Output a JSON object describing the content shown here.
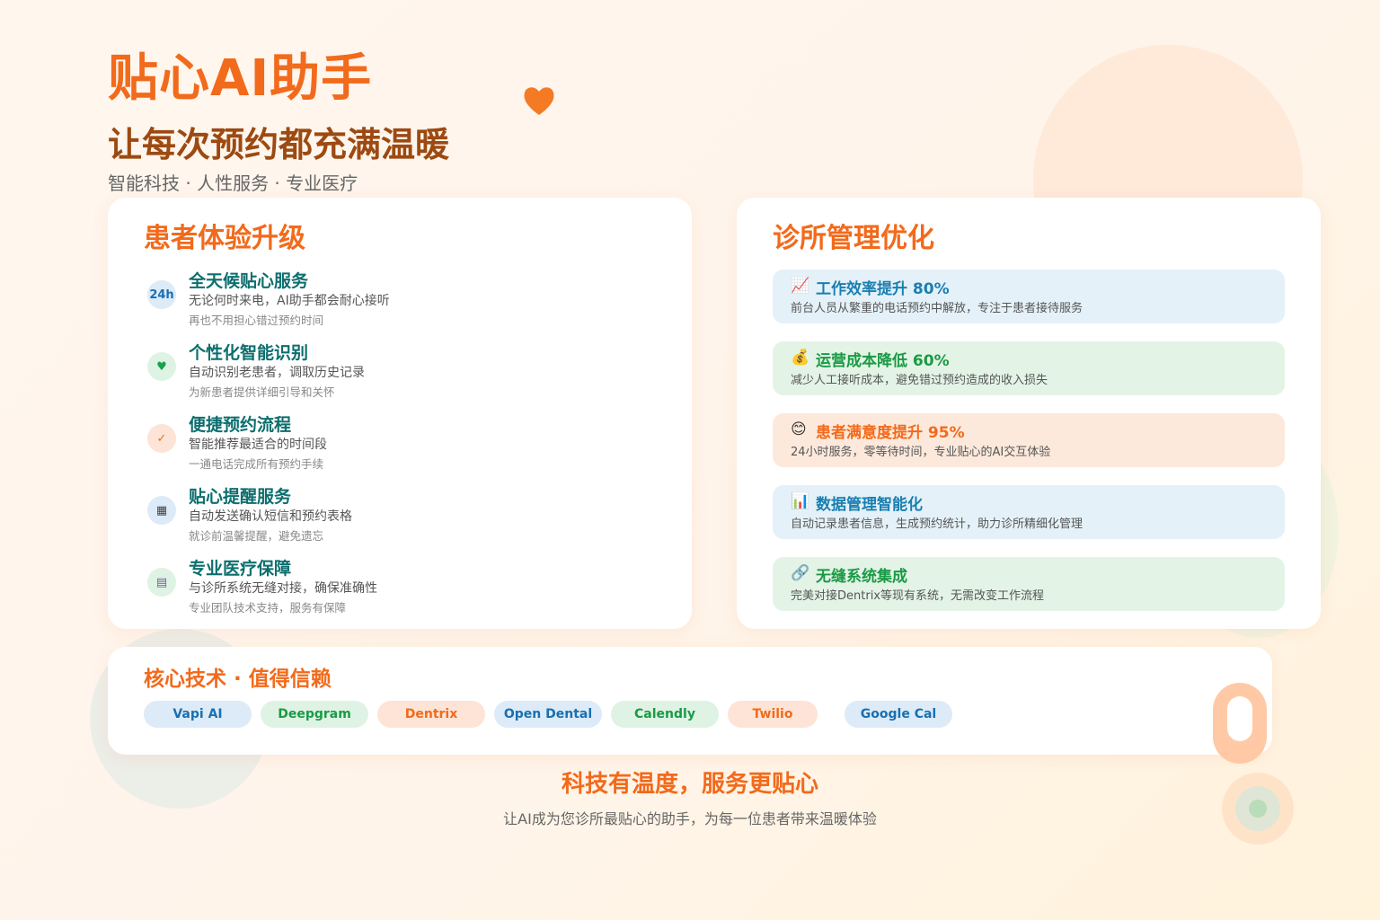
{
  "header": {
    "title": "贴心AI助手",
    "subtitle": "让每次预约都充满温暖",
    "tagline": "智能科技 · 人性服务 · 专业医疗",
    "heart_icon": "heart-icon"
  },
  "patient_card": {
    "title": "患者体验升级",
    "features": [
      {
        "icon_text": "24h",
        "icon": "clock-24h-icon",
        "icon_bg": "#dcebf7",
        "icon_color": "#1a6fb0",
        "title": "全天候贴心服务",
        "desc": "无论何时来电，AI助手都会耐心接听",
        "note": "再也不用担心错过预约时间"
      },
      {
        "icon_text": "♥",
        "icon": "green-heart-icon",
        "icon_bg": "#dff3e4",
        "icon_color": "#1aa24a",
        "title": "个性化智能识别",
        "desc": "自动识别老患者，调取历史记录",
        "note": "为新患者提供详细引导和关怀"
      },
      {
        "icon_text": "✓",
        "icon": "check-icon",
        "icon_bg": "#fde4d6",
        "icon_color": "#f26a1b",
        "title": "便捷预约流程",
        "desc": "智能推荐最适合的时间段",
        "note": "一通电话完成所有预约手续"
      },
      {
        "icon_text": "▦",
        "icon": "phone-icon",
        "icon_bg": "#dcebf7",
        "icon_color": "#444",
        "title": "贴心提醒服务",
        "desc": "自动发送确认短信和预约表格",
        "note": "就诊前温馨提醒，避免遗忘"
      },
      {
        "icon_text": "▤",
        "icon": "clipboard-icon",
        "icon_bg": "#dff3e4",
        "icon_color": "#7a5aa8",
        "title": "专业医疗保障",
        "desc": "与诊所系统无缝对接，确保准确性",
        "note": "专业团队技术支持，服务有保障"
      }
    ]
  },
  "clinic_card": {
    "title": "诊所管理优化",
    "metrics": [
      {
        "icon_text": "📈",
        "icon": "chart-up-icon",
        "bg": "#e4f1f8",
        "color": "#1a7fb0",
        "title": "工作效率提升 80%",
        "desc": "前台人员从繁重的电话预约中解放，专注于患者接待服务"
      },
      {
        "icon_text": "💰",
        "icon": "money-bag-icon",
        "bg": "#e3f4e6",
        "color": "#1a9a45",
        "title": "运营成本降低 60%",
        "desc": "减少人工接听成本，避免错过预约造成的收入损失"
      },
      {
        "icon_text": "😊",
        "icon": "smile-icon",
        "bg": "#fde9dc",
        "color": "#f26a1b",
        "title": "患者满意度提升 95%",
        "desc": "24小时服务，零等待时间，专业贴心的AI交互体验"
      },
      {
        "icon_text": "📊",
        "icon": "bar-chart-icon",
        "bg": "#e4f1f8",
        "color": "#1a7fb0",
        "title": "数据管理智能化",
        "desc": "自动记录患者信息，生成预约统计，助力诊所精细化管理"
      },
      {
        "icon_text": "🔗",
        "icon": "link-icon",
        "bg": "#e3f4e6",
        "color": "#1a9a45",
        "title": "无缝系统集成",
        "desc": "完美对接Dentrix等现有系统，无需改变工作流程"
      }
    ]
  },
  "tech": {
    "title": "核心技术 · 值得信赖",
    "chips": [
      {
        "label": "Vapi AI",
        "bg": "#dcebf7",
        "color": "#1a6fb0"
      },
      {
        "label": "Deepgram",
        "bg": "#dff3e4",
        "color": "#1a9a45"
      },
      {
        "label": "Dentrix",
        "bg": "#fde4d6",
        "color": "#f26a1b"
      },
      {
        "label": "Open Dental",
        "bg": "#dcebf7",
        "color": "#1a6fb0"
      },
      {
        "label": "Calendly",
        "bg": "#dff3e4",
        "color": "#1a9a45"
      },
      {
        "label": "Twilio",
        "bg": "#fde4d6",
        "color": "#f26a1b"
      },
      {
        "label": "Google Cal",
        "bg": "#dcebf7",
        "color": "#1a6fb0"
      }
    ]
  },
  "footer": {
    "title": "科技有温度，服务更贴心",
    "subtitle": "让AI成为您诊所最贴心的助手，为每一位患者带来温暖体验"
  }
}
